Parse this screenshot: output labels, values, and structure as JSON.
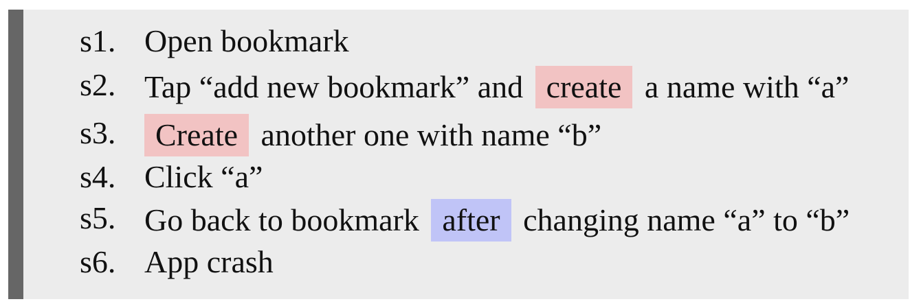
{
  "steps": [
    {
      "num": "s1.",
      "before": "Open bookmark",
      "highlight": "",
      "after": ""
    },
    {
      "num": "s2.",
      "before": "Tap “add new bookmark” and",
      "highlight": "create",
      "after": "a name with “a”"
    },
    {
      "num": "s3.",
      "before": "",
      "highlight": "Create",
      "after": "another one with name “b”"
    },
    {
      "num": "s4.",
      "before": "Click “a”",
      "highlight": "",
      "after": ""
    },
    {
      "num": "s5.",
      "before": "Go back to bookmark",
      "highlight": "after",
      "after": "changing name “a” to “b”"
    },
    {
      "num": "s6.",
      "before": "App crash",
      "highlight": "",
      "after": ""
    }
  ],
  "colors": {
    "highlight_red": "#f2c3c3",
    "highlight_blue": "#c0c4f7",
    "panel_bg": "#ececec",
    "bar": "#666666"
  }
}
